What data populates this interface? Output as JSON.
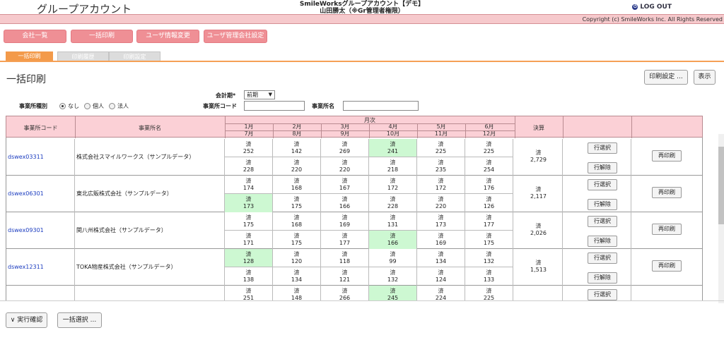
{
  "header": {
    "app_title": "グループアカウント",
    "center_line1": "SmileWorksグループアカウント【デモ】",
    "center_line2": "山田勝太（※Gr管理者権限）",
    "logout_label": "LOG OUT",
    "copyright": "Copyright (c) SmileWorks Inc. All Rights Reserved"
  },
  "nav": [
    "会社一覧",
    "一括印刷",
    "ユーザ情報変更",
    "ユーザ管理会社設定"
  ],
  "tabs": [
    "一括印刷",
    "印刷履歴",
    "印刷設定"
  ],
  "page_title": "一括印刷",
  "buttons": {
    "print_settings": "印刷設定 ...",
    "display": "表示",
    "exec_confirm": "∨ 実行確認",
    "bulk_select": "一括選択 ..."
  },
  "filters": {
    "period_label": "会計期*",
    "period_value": "前期",
    "office_type_label": "事業所種別",
    "radio": [
      "なし",
      "個人",
      "法人"
    ],
    "office_code_label": "事業所コード",
    "office_name_label": "事業所名"
  },
  "table_header": {
    "code": "事業所コード",
    "name": "事業所名",
    "monthly": "月次",
    "months_top": [
      "1月",
      "2月",
      "3月",
      "4月",
      "5月",
      "6月"
    ],
    "months_bottom": [
      "7月",
      "8月",
      "9月",
      "10月",
      "11月",
      "12月"
    ],
    "settlement": "決算"
  },
  "row_labels": {
    "done": "済",
    "select": "行選択",
    "release": "行解除",
    "reprint": "再印刷"
  },
  "rows": [
    {
      "code": "dswex03311",
      "name": "株式会社スマイルワークス（サンプルデータ）",
      "top": [
        "252",
        "142",
        "269",
        "241",
        "225",
        "225"
      ],
      "bottom": [
        "228",
        "220",
        "220",
        "218",
        "235",
        "254"
      ],
      "settlement": "2,729"
    },
    {
      "code": "dswex06301",
      "name": "東北広販株式会社（サンプルデータ）",
      "top": [
        "174",
        "168",
        "167",
        "172",
        "172",
        "176"
      ],
      "bottom": [
        "173",
        "175",
        "166",
        "228",
        "220",
        "126"
      ],
      "settlement": "2,117"
    },
    {
      "code": "dswex09301",
      "name": "関八州株式会社（サンプルデータ）",
      "top": [
        "175",
        "168",
        "169",
        "131",
        "173",
        "177"
      ],
      "bottom": [
        "171",
        "175",
        "177",
        "166",
        "169",
        "175"
      ],
      "settlement": "2,026"
    },
    {
      "code": "dswex12311",
      "name": "TOKA物産株式会社（サンプルデータ）",
      "top": [
        "128",
        "120",
        "118",
        "99",
        "134",
        "132"
      ],
      "bottom": [
        "138",
        "134",
        "121",
        "132",
        "124",
        "133"
      ],
      "settlement": "1,513"
    },
    {
      "code": "",
      "name": "",
      "top": [
        "251",
        "148",
        "266",
        "245",
        "224",
        "225"
      ],
      "bottom": [
        "",
        "",
        "",
        "",
        "",
        ""
      ],
      "settlement": ""
    }
  ]
}
